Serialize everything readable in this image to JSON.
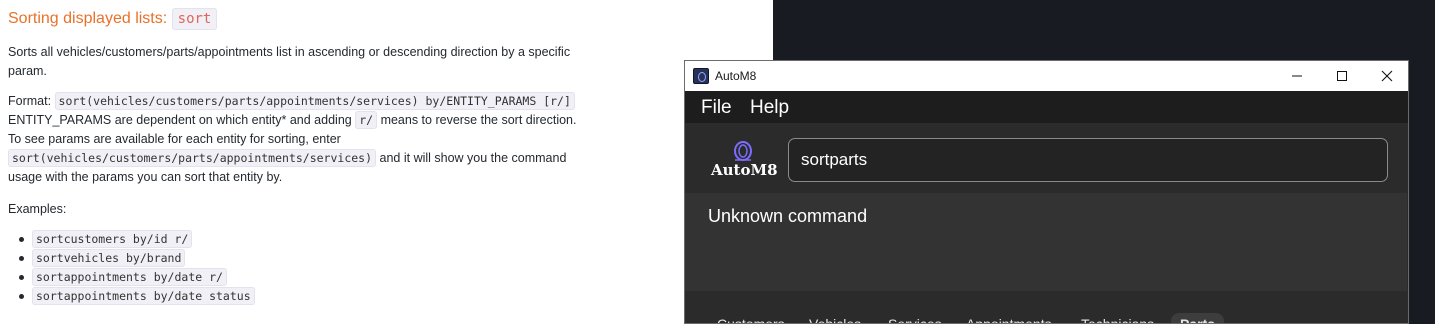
{
  "doc": {
    "heading": "Sorting displayed lists:",
    "heading_code": "sort",
    "description": "Sorts all vehicles/customers/parts/appointments list in ascending or descending direction by a specific",
    "description_cont": "param.",
    "format_label": "Format:",
    "format_code": "sort(vehicles/customers/parts/appointments/services) by/ENTITY_PARAMS [r/]",
    "line2_a": "ENTITY_PARAMS are dependent on which entity* and adding",
    "line2_code": "r/",
    "line2_b": "means to reverse the sort direction.",
    "line3": "To see params are available for each entity for sorting, enter",
    "line4_code": "sort(vehicles/customers/parts/appointments/services)",
    "line4_b": "and it will show you the command",
    "line5": "usage with the params you can sort that entity by.",
    "examples_label": "Examples:",
    "examples": [
      "sortcustomers by/id r/",
      "sortvehicles by/brand",
      "sortappointments by/date r/",
      "sortappointments by/date status"
    ]
  },
  "window": {
    "title": "AutoM8",
    "menu": {
      "file": "File",
      "help": "Help"
    },
    "logo_text": "AutoM8",
    "command_value": "sortparts",
    "result": "Unknown command",
    "tabs": [
      "Customers",
      "Vehicles",
      "Services",
      "Appointments",
      "Technicians",
      "Parts"
    ],
    "active_tab": "Parts"
  },
  "colors": {
    "heading": "#e8712a",
    "desktop_bg": "#181b22",
    "window_bg": "#2b2b2b",
    "menubar_bg": "#1d1d1d",
    "result_bg": "#333333"
  },
  "icons": [
    "app-icon",
    "minimize-icon",
    "maximize-icon",
    "close-icon",
    "logo-icon"
  ]
}
